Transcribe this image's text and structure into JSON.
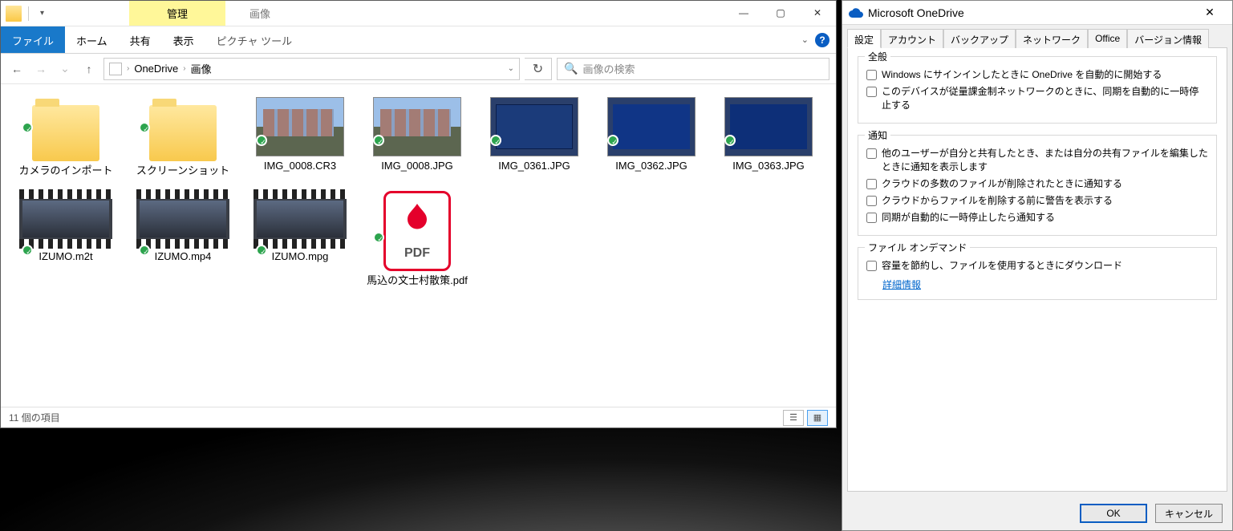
{
  "explorer": {
    "context_tab": "管理",
    "window_title": "画像",
    "ribbon": {
      "file": "ファイル",
      "home": "ホーム",
      "share": "共有",
      "view": "表示",
      "picture_tools": "ピクチャ ツール"
    },
    "breadcrumbs": [
      "OneDrive",
      "画像"
    ],
    "search_placeholder": "画像の検索",
    "status": "11 個の項目",
    "items": [
      {
        "type": "folder",
        "label": "カメラのインポート"
      },
      {
        "type": "folder",
        "label": "スクリーンショット"
      },
      {
        "type": "img-city",
        "label": "IMG_0008.CR3"
      },
      {
        "type": "img-city",
        "label": "IMG_0008.JPG"
      },
      {
        "type": "img-blue",
        "label": "IMG_0361.JPG"
      },
      {
        "type": "img-blue2",
        "label": "IMG_0362.JPG"
      },
      {
        "type": "img-blue3",
        "label": "IMG_0363.JPG"
      },
      {
        "type": "video",
        "label": "IZUMO.m2t"
      },
      {
        "type": "video",
        "label": "IZUMO.mp4"
      },
      {
        "type": "video",
        "label": "IZUMO.mpg"
      },
      {
        "type": "pdf",
        "label": "馬込の文士村散策.pdf",
        "pdf_text": "PDF"
      }
    ]
  },
  "onedrive": {
    "title": "Microsoft OneDrive",
    "tabs": [
      "設定",
      "アカウント",
      "バックアップ",
      "ネットワーク",
      "Office",
      "バージョン情報"
    ],
    "group_general": "全般",
    "opt_start": "Windows にサインインしたときに OneDrive を自動的に開始する",
    "opt_metered": "このデバイスが従量課金制ネットワークのときに、同期を自動的に一時停止する",
    "group_notify": "通知",
    "opt_share": "他のユーザーが自分と共有したとき、または自分の共有ファイルを編集したときに通知を表示します",
    "opt_delete_many": "クラウドの多数のファイルが削除されたときに通知する",
    "opt_delete_warn": "クラウドからファイルを削除する前に警告を表示する",
    "opt_pause": "同期が自動的に一時停止したら通知する",
    "group_fod": "ファイル オンデマンド",
    "opt_fod": "容量を節約し、ファイルを使用するときにダウンロード",
    "link_more": "詳細情報",
    "btn_ok": "OK",
    "btn_cancel": "キャンセル"
  }
}
